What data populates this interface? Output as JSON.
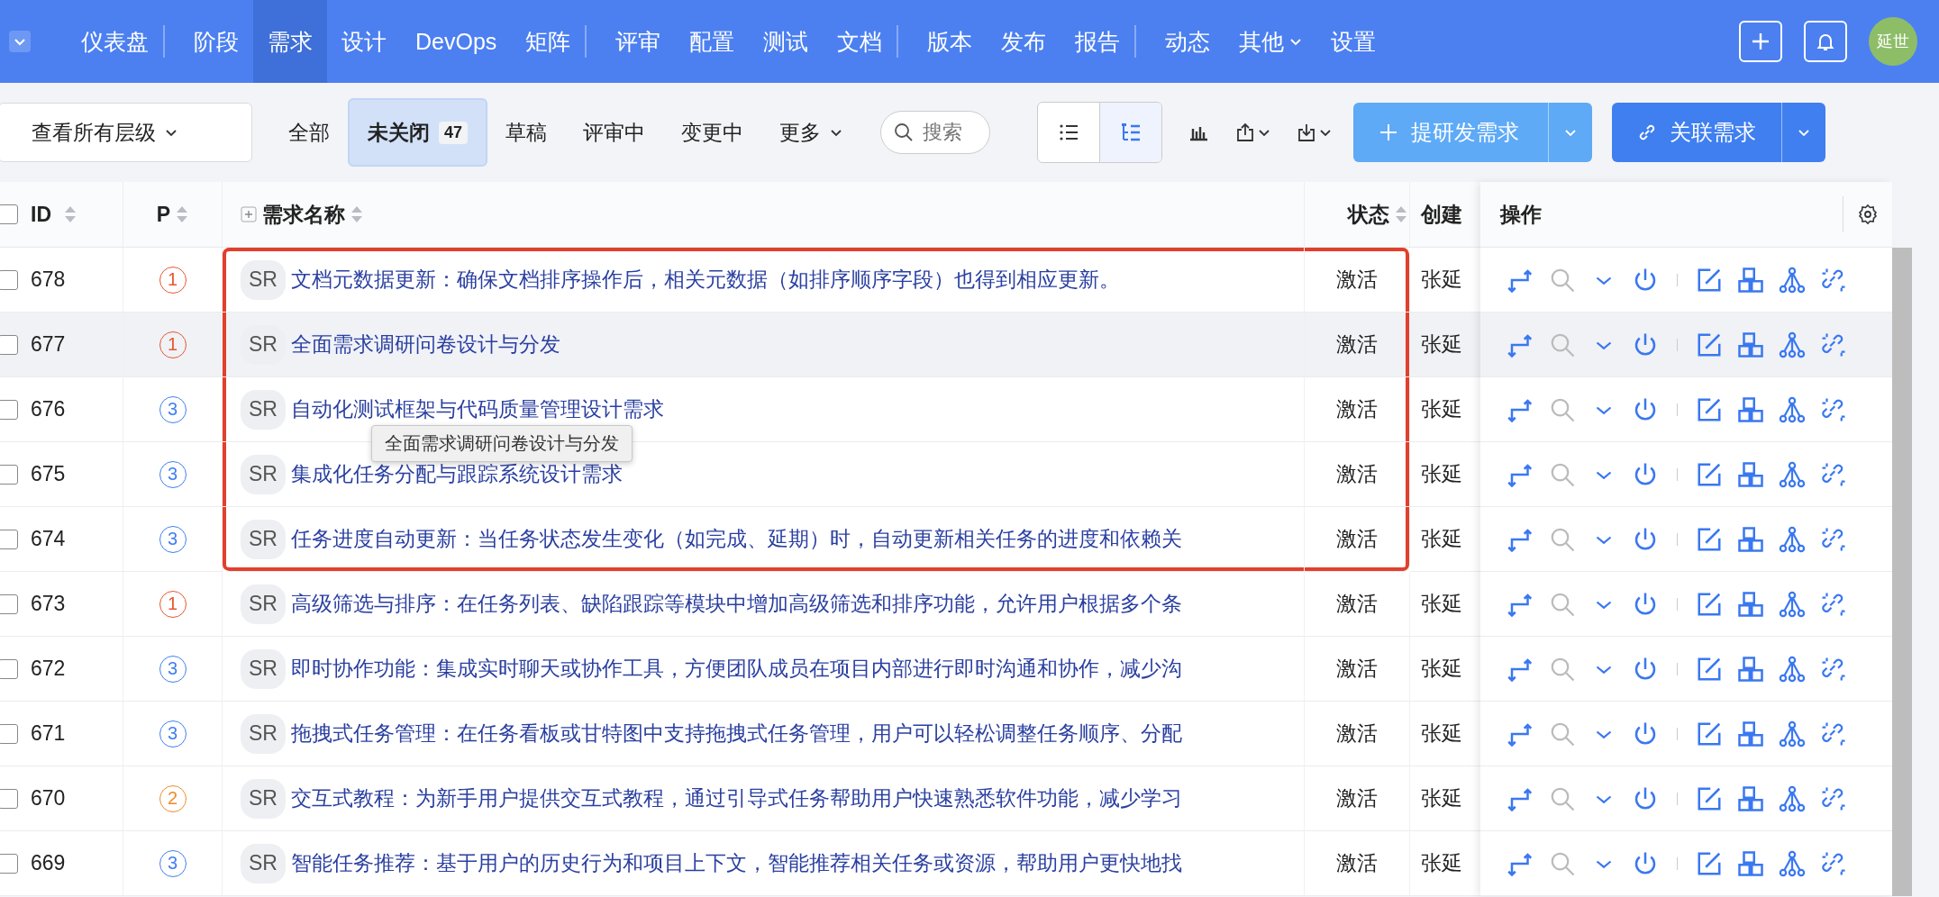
{
  "nav": {
    "items": [
      {
        "label": "仪表盘",
        "selected": false,
        "divider_before": false,
        "dropdown": false
      },
      {
        "label": "阶段",
        "selected": false,
        "divider_before": true,
        "dropdown": false
      },
      {
        "label": "需求",
        "selected": true,
        "divider_before": false,
        "dropdown": false
      },
      {
        "label": "设计",
        "selected": false,
        "divider_before": false,
        "dropdown": false
      },
      {
        "label": "DevOps",
        "selected": false,
        "divider_before": false,
        "dropdown": false
      },
      {
        "label": "矩阵",
        "selected": false,
        "divider_before": false,
        "dropdown": false
      },
      {
        "label": "评审",
        "selected": false,
        "divider_before": true,
        "dropdown": false
      },
      {
        "label": "配置",
        "selected": false,
        "divider_before": false,
        "dropdown": false
      },
      {
        "label": "测试",
        "selected": false,
        "divider_before": false,
        "dropdown": false
      },
      {
        "label": "文档",
        "selected": false,
        "divider_before": false,
        "dropdown": false
      },
      {
        "label": "版本",
        "selected": false,
        "divider_before": true,
        "dropdown": false
      },
      {
        "label": "发布",
        "selected": false,
        "divider_before": false,
        "dropdown": false
      },
      {
        "label": "报告",
        "selected": false,
        "divider_before": false,
        "dropdown": false
      },
      {
        "label": "动态",
        "selected": false,
        "divider_before": true,
        "dropdown": false
      },
      {
        "label": "其他",
        "selected": false,
        "divider_before": false,
        "dropdown": true
      },
      {
        "label": "设置",
        "selected": false,
        "divider_before": false,
        "dropdown": false
      }
    ],
    "avatar": "延世"
  },
  "toolbar": {
    "level_select": "查看所有层级",
    "filters": [
      {
        "label": "全部",
        "selected": false
      },
      {
        "label": "未关闭",
        "count": "47",
        "selected": true
      },
      {
        "label": "草稿",
        "selected": false
      },
      {
        "label": "评审中",
        "selected": false
      },
      {
        "label": "变更中",
        "selected": false
      }
    ],
    "more": "更多",
    "search": {
      "placeholder": "搜索"
    },
    "views": [
      {
        "kind": "list",
        "selected": false
      },
      {
        "kind": "tree",
        "selected": true
      }
    ],
    "create_button": "提研发需求",
    "link_button": "关联需求"
  },
  "table": {
    "select_all_checked": false,
    "columns": [
      {
        "label": "ID",
        "sortable": true,
        "expandable": false
      },
      {
        "label": "P",
        "sortable": true,
        "expandable": false
      },
      {
        "label": "需求名称",
        "sortable": true,
        "expandable": true
      },
      {
        "label": "状态",
        "sortable": true,
        "expandable": false
      },
      {
        "label": "创建",
        "sortable": false,
        "expandable": false
      }
    ],
    "actions_header": "操作",
    "rows": [
      {
        "id": "678",
        "checked": false,
        "priority": "1",
        "color": "#e8572f",
        "type": "SR",
        "name": "文档元数据更新：确保文档排序操作后，相关元数据（如排序顺序字段）也得到相应更新。",
        "status": "激活",
        "creator": "张延",
        "hovered": false,
        "highlighted": true
      },
      {
        "id": "677",
        "checked": false,
        "priority": "1",
        "color": "#e8572f",
        "type": "SR",
        "name": "全面需求调研问卷设计与分发",
        "status": "激活",
        "creator": "张延",
        "hovered": true,
        "highlighted": true
      },
      {
        "id": "676",
        "checked": false,
        "priority": "3",
        "color": "#3f7ff0",
        "type": "SR",
        "name": "自动化测试框架与代码质量管理设计需求",
        "status": "激活",
        "creator": "张延",
        "hovered": false,
        "highlighted": true
      },
      {
        "id": "675",
        "checked": false,
        "priority": "3",
        "color": "#3f7ff0",
        "type": "SR",
        "name": "集成化任务分配与跟踪系统设计需求",
        "status": "激活",
        "creator": "张延",
        "hovered": false,
        "highlighted": true
      },
      {
        "id": "674",
        "checked": false,
        "priority": "3",
        "color": "#3f7ff0",
        "type": "SR",
        "name": "任务进度自动更新：当任务状态发生变化（如完成、延期）时，自动更新相关任务的进度和依赖关",
        "status": "激活",
        "creator": "张延",
        "hovered": false,
        "highlighted": true
      },
      {
        "id": "673",
        "checked": false,
        "priority": "1",
        "color": "#e8572f",
        "type": "SR",
        "name": "高级筛选与排序：在任务列表、缺陷跟踪等模块中增加高级筛选和排序功能，允许用户根据多个条",
        "status": "激活",
        "creator": "张延",
        "hovered": false,
        "highlighted": false
      },
      {
        "id": "672",
        "checked": false,
        "priority": "3",
        "color": "#3f7ff0",
        "type": "SR",
        "name": "即时协作功能：集成实时聊天或协作工具，方便团队成员在项目内部进行即时沟通和协作，减少沟",
        "status": "激活",
        "creator": "张延",
        "hovered": false,
        "highlighted": false
      },
      {
        "id": "671",
        "checked": false,
        "priority": "3",
        "color": "#3f7ff0",
        "type": "SR",
        "name": "拖拽式任务管理：在任务看板或甘特图中支持拖拽式任务管理，用户可以轻松调整任务顺序、分配",
        "status": "激活",
        "creator": "张延",
        "hovered": false,
        "highlighted": false
      },
      {
        "id": "670",
        "checked": false,
        "priority": "2",
        "color": "#f08c28",
        "type": "SR",
        "name": "交互式教程：为新手用户提供交互式教程，通过引导式任务帮助用户快速熟悉软件功能，减少学习",
        "status": "激活",
        "creator": "张延",
        "hovered": false,
        "highlighted": false
      },
      {
        "id": "669",
        "checked": false,
        "priority": "3",
        "color": "#3f7ff0",
        "type": "SR",
        "name": "智能任务推荐：基于用户的历史行为和项目上下文，智能推荐相关任务或资源，帮助用户更快地找",
        "status": "激活",
        "creator": "张延",
        "hovered": false,
        "highlighted": false
      }
    ]
  },
  "tooltip": {
    "text": "全面需求调研问卷设计与分发"
  }
}
